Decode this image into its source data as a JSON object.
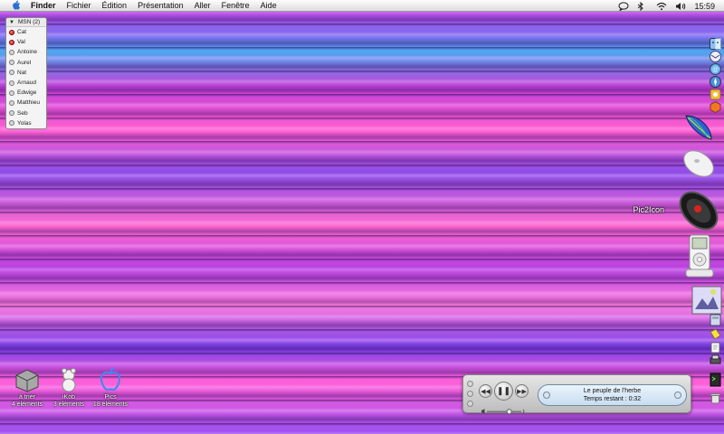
{
  "menubar": {
    "apple_icon": "apple-icon",
    "items": [
      "Finder",
      "Fichier",
      "Édition",
      "Présentation",
      "Aller",
      "Fenêtre",
      "Aide"
    ],
    "clock": "15:59"
  },
  "msn": {
    "title": "MSN (2)",
    "contacts": [
      {
        "name": "Cat",
        "status": "busy"
      },
      {
        "name": "Val",
        "status": "busy"
      },
      {
        "name": "Antoine",
        "status": "offline"
      },
      {
        "name": "Aurel",
        "status": "offline"
      },
      {
        "name": "Nat",
        "status": "offline"
      },
      {
        "name": "Arnaud",
        "status": "offline"
      },
      {
        "name": "Edwige",
        "status": "offline"
      },
      {
        "name": "Matthieu",
        "status": "offline"
      },
      {
        "name": "Seb",
        "status": "offline"
      },
      {
        "name": "Yolas",
        "status": "offline"
      }
    ]
  },
  "dock": {
    "hover_label": "Pic2Icon"
  },
  "desktop": {
    "icons": [
      {
        "name": "à trier",
        "sub": "4 éléments"
      },
      {
        "name": "iKob",
        "sub": "3 éléments"
      },
      {
        "name": "Pics",
        "sub": "18 éléments"
      }
    ]
  },
  "player": {
    "track": "Le peuple de l'herbe",
    "time": "Temps restant : 0:32",
    "volume_fraction": 0.65
  },
  "colors": {
    "busy": "#c00000",
    "lcd": "#d8e8f6"
  }
}
